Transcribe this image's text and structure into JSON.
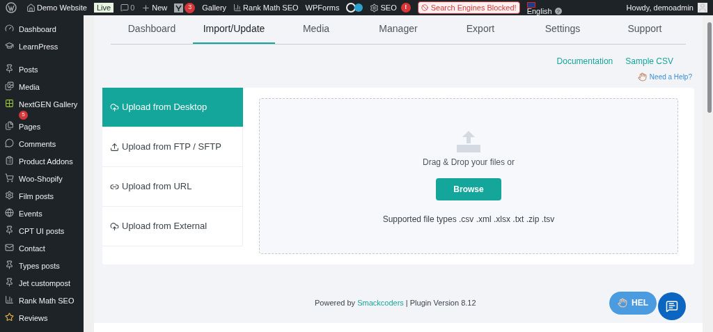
{
  "admin_bar": {
    "site": "Demo Website",
    "live_badge": "Live",
    "comments": "0",
    "new": "New",
    "yoast_count": "3",
    "gallery": "Gallery",
    "rank_math": "Rank Math SEO",
    "wpforms": "WPForms",
    "seo": "SEO",
    "seo_alert": "!",
    "search_blocked": "Search Engines Blocked!",
    "language": "English",
    "language_help": "?",
    "greeting": "Howdy, demoadmin"
  },
  "sidebar": {
    "items": [
      {
        "label": "Dashboard",
        "kind": "gauge"
      },
      {
        "label": "LearnPress",
        "kind": "cap"
      },
      {
        "kind": "separator"
      },
      {
        "label": "Posts",
        "kind": "pin"
      },
      {
        "label": "Media",
        "kind": "media"
      },
      {
        "label": "NextGEN Gallery",
        "kind": "nextgen",
        "badge": "5"
      },
      {
        "label": "Pages",
        "kind": "pages"
      },
      {
        "label": "Comments",
        "kind": "comment"
      },
      {
        "label": "Product Addons",
        "kind": "clipboard"
      },
      {
        "label": "Woo-Shopify",
        "kind": "cart"
      },
      {
        "label": "Film posts",
        "kind": "gear"
      },
      {
        "label": "Events",
        "kind": "globe"
      },
      {
        "label": "CPT UI posts",
        "kind": "pin"
      },
      {
        "label": "Contact",
        "kind": "mail"
      },
      {
        "label": "Types posts",
        "kind": "pin"
      },
      {
        "label": "Jet custompost",
        "kind": "pin"
      },
      {
        "label": "Rank Math SEO",
        "kind": "chart"
      },
      {
        "label": "Reviews",
        "kind": "star"
      }
    ]
  },
  "tabs": [
    {
      "label": "Dashboard",
      "selected": false
    },
    {
      "label": "Import/Update",
      "selected": true
    },
    {
      "label": "Media",
      "selected": false
    },
    {
      "label": "Manager",
      "selected": false
    },
    {
      "label": "Export",
      "selected": false
    },
    {
      "label": "Settings",
      "selected": false
    },
    {
      "label": "Support",
      "selected": false
    }
  ],
  "links": {
    "documentation": "Documentation",
    "sample_csv": "Sample CSV",
    "need_help": "Need a Help?"
  },
  "upload_options": [
    {
      "label": "Upload from Desktop",
      "kind": "cloud-up",
      "selected": true
    },
    {
      "label": "Upload from FTP / SFTP",
      "kind": "upload",
      "selected": false
    },
    {
      "label": "Upload from URL",
      "kind": "link",
      "selected": false
    },
    {
      "label": "Upload from External",
      "kind": "cloud-up",
      "selected": false
    }
  ],
  "dropzone": {
    "prompt": "Drag & Drop your files or",
    "button": "Browse",
    "supported": "Supported file types .csv .xml .xlsx .txt .zip .tsv"
  },
  "footer": {
    "prefix": "Powered by",
    "link": "Smackcoders",
    "suffix": "| Plugin Version 8.12"
  },
  "help_button": "HEL"
}
